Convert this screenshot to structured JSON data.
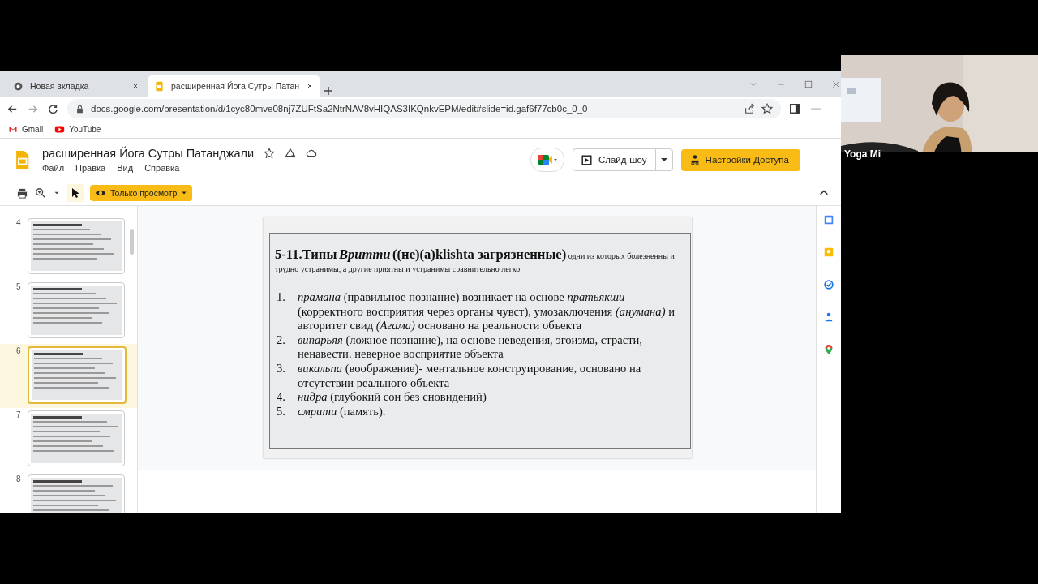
{
  "browser": {
    "tabs": [
      {
        "title": "Новая вкладка",
        "kind": "chrome",
        "selected": false
      },
      {
        "title": "расширенная Йога Сутры Патан",
        "kind": "slides",
        "selected": true
      }
    ],
    "url": "docs.google.com/presentation/d/1cyc80mve08nj7ZUFtSa2NtrNAV8vHIQAS3IKQnkvEPM/edit#slide=id.gaf6f77cb0c_0_0",
    "bookmarks": [
      {
        "label": "Gmail",
        "kind": "gmail"
      },
      {
        "label": "YouTube",
        "kind": "youtube"
      }
    ]
  },
  "document": {
    "title": "расширенная Йога Сутры Патанджали",
    "menu": [
      "Файл",
      "Правка",
      "Вид",
      "Справка"
    ],
    "slideshow_button": "Слайд-шоу",
    "share_button": "Настройки Доступа",
    "view_mode": "Только просмотр"
  },
  "filmstrip": [
    {
      "number": "4",
      "selected": false
    },
    {
      "number": "5",
      "selected": false
    },
    {
      "number": "6",
      "selected": true
    },
    {
      "number": "7",
      "selected": false
    },
    {
      "number": "8",
      "selected": false
    }
  ],
  "slide": {
    "heading": {
      "lead": "5-11.Типы",
      "term": "Вритти",
      "qualifier": "((не)(а)klishta загрязненные)",
      "rest": "одни из которых болезненны и трудно устранимы, а другие приятны и устранимы сравнительно легко"
    },
    "items": [
      {
        "marker": "1.",
        "text": "*прамана* (правильное познание) возникает на основе *пратьякши* (корректного восприятия через органы чувст), умозаключения *(анумана)* и авторитет свид *(Агама)* основано на реальности объекта"
      },
      {
        "marker": "2.",
        "text": "*випарьяя* (ложное познание), на основе неведения, эгоизма, страсти, ненавести. неверное восприятие объекта"
      },
      {
        "marker": "3.",
        "text": "*викальпа* (воображение)- ментальное конструирование, основано на отсутствии реального объекта"
      },
      {
        "marker": "4.",
        "text": "*нидра* (глубокий сон без сновидений)"
      },
      {
        "marker": "5.",
        "text": "*смрити* (память)."
      }
    ]
  },
  "video_tile": {
    "name": "Yoga Mi"
  }
}
